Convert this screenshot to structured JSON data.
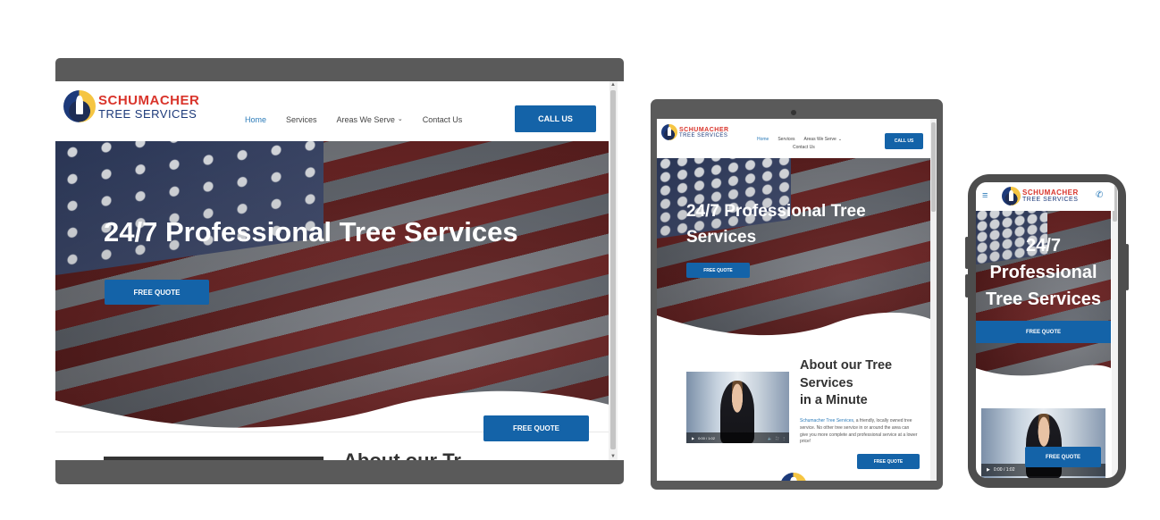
{
  "brand": {
    "line1": "SCHUMACHER",
    "line2": "TREE SERVICES"
  },
  "colors": {
    "accent": "#1463a8",
    "link": "#2b7bb9",
    "brand_red": "#d9342b",
    "brand_navy": "#1d3a7a",
    "device_frame": "#5a5a5a"
  },
  "nav": {
    "items": [
      {
        "label": "Home",
        "active": true
      },
      {
        "label": "Services",
        "active": false
      },
      {
        "label": "Areas We Serve",
        "active": false
      },
      {
        "label": "Contact Us",
        "active": false
      }
    ],
    "dropdown_icon": "chevron-down-icon"
  },
  "cta": {
    "call": "CALL US",
    "quote": "FREE QUOTE"
  },
  "hero": {
    "title": "24/7 Professional Tree Services",
    "tablet_title": [
      "24/7 Professional Tree",
      "Services"
    ],
    "phone_title": [
      "24/7",
      "Professional",
      "Tree Services"
    ]
  },
  "about": {
    "title": [
      "About our Tree",
      "Services",
      "in a Minute"
    ],
    "desktop_title_partial": "About our Tr",
    "company_link": "Schumacher Tree Services",
    "body": ", a friendly, locally owned tree service. No other tree service in or around the area can give you more complete and professional service at a lower price!",
    "video_time": "0:00 / 1:02"
  },
  "icons": {
    "menu": "hamburger-icon",
    "phone": "phone-icon",
    "play": "play-icon",
    "volume": "volume-icon",
    "fullscreen": "fullscreen-icon",
    "more": "more-icon"
  }
}
